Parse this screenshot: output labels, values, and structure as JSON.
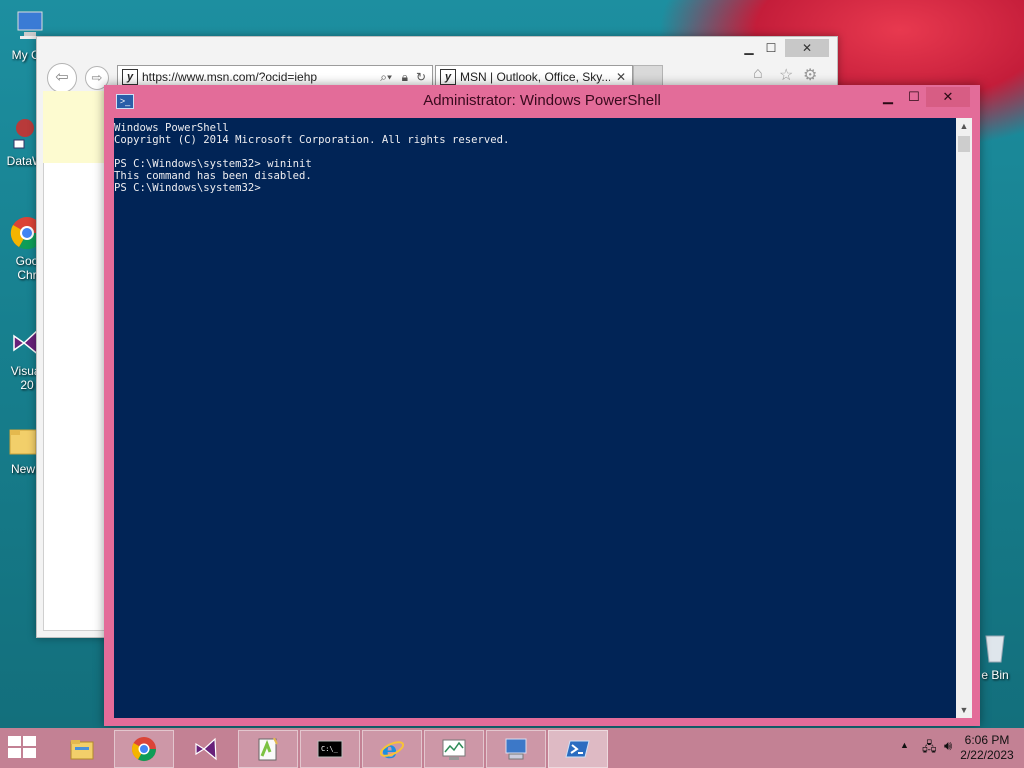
{
  "desktop": {
    "icons": [
      {
        "label": "My Co",
        "name": "my-computer"
      },
      {
        "label": "DataW",
        "name": "dataw"
      },
      {
        "label": "Goo\nChr",
        "name": "google-chrome"
      },
      {
        "label": "Visual\n20",
        "name": "visual-studio"
      },
      {
        "label": "New",
        "name": "new-folder"
      },
      {
        "label": "e Bin",
        "name": "recycle-bin"
      }
    ]
  },
  "ie": {
    "address": "https://www.msn.com/?ocid=iehp",
    "tab_title": "MSN | Outlook, Office, Sky...",
    "tab_close": "✕",
    "controls": {
      "minimize": "▁",
      "maximize": "☐",
      "close": "✕"
    }
  },
  "powershell": {
    "title": "Administrator: Windows PowerShell",
    "controls": {
      "minimize": "▁",
      "maximize": "☐",
      "close": "✕"
    },
    "lines": [
      "Windows PowerShell",
      "Copyright (C) 2014 Microsoft Corporation. All rights reserved.",
      "",
      "PS C:\\Windows\\system32> wininit",
      "This command has been disabled.",
      "PS C:\\Windows\\system32>"
    ]
  },
  "taskbar": {
    "items": [
      "file-explorer",
      "google-chrome",
      "visual-studio",
      "notepad-plus-plus",
      "command-prompt",
      "internet-explorer",
      "resource-monitor",
      "remote-desktop",
      "powershell"
    ],
    "active": "powershell",
    "clock": {
      "time": "6:06 PM",
      "date": "2/22/2023"
    }
  },
  "colors": {
    "console_bg": "#012456",
    "console_fg": "#EEEDF0",
    "titlebar": "#E36C99",
    "taskbar": "#C38194"
  }
}
